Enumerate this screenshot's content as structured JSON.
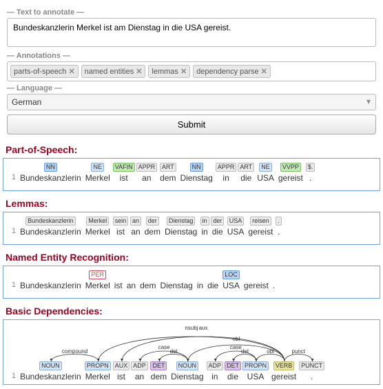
{
  "form": {
    "text_legend": "— Text to annotate —",
    "text_value": "Bundeskanzlerin Merkel ist am Dienstag in die USA gereist.",
    "annotations_legend": "— Annotations —",
    "tags": [
      {
        "label": "parts-of-speech"
      },
      {
        "label": "named entities"
      },
      {
        "label": "lemmas"
      },
      {
        "label": "dependency parse"
      }
    ],
    "tag_close": "✕",
    "language_legend": "— Language —",
    "language_value": "German",
    "submit_label": "Submit"
  },
  "sections": {
    "pos_title": "Part-of-Speech:",
    "lemma_title": "Lemmas:",
    "ner_title": "Named Entity Recognition:",
    "dep_title": "Basic Dependencies:",
    "line_num": "1"
  },
  "sentence_tokens": [
    "Bundeskanzlerin",
    "Merkel",
    "ist",
    "an",
    "dem",
    "Dienstag",
    "in",
    "die",
    "USA",
    "gereist",
    "."
  ],
  "pos_tags": [
    {
      "tag": "NN",
      "cls": "c-blue"
    },
    {
      "tag": "NE",
      "cls": "c-lblue"
    },
    {
      "tag": "VAFIN",
      "cls": "c-green"
    },
    {
      "tag": "APPR",
      "cls": "c-gray"
    },
    {
      "tag": "ART",
      "cls": "c-gray"
    },
    {
      "tag": "NN",
      "cls": "c-blue"
    },
    {
      "tag": "APPR",
      "cls": "c-gray"
    },
    {
      "tag": "ART",
      "cls": "c-gray"
    },
    {
      "tag": "NE",
      "cls": "c-lblue"
    },
    {
      "tag": "VVPP",
      "cls": "c-green"
    },
    {
      "tag": "$.",
      "cls": "c-gray"
    }
  ],
  "lemmas": [
    "Bundeskanzlerin",
    "Merkel",
    "sein",
    "an",
    "der",
    "Dienstag",
    "in",
    "der",
    "USA",
    "reisen",
    "."
  ],
  "ner": [
    {
      "word": "Bundeskanzlerin"
    },
    {
      "word": "Merkel",
      "tag": "PER",
      "cls": "c-red"
    },
    {
      "word": "ist"
    },
    {
      "word": "an"
    },
    {
      "word": "dem"
    },
    {
      "word": "Dienstag"
    },
    {
      "word": "in"
    },
    {
      "word": "die"
    },
    {
      "word": "USA",
      "tag": "LOC",
      "cls": "c-blue"
    },
    {
      "word": "gereist"
    },
    {
      "word": "."
    }
  ],
  "dep_tokens": [
    {
      "word": "Bundeskanzlerin",
      "tag": "NOUN",
      "cls": "c-lblue"
    },
    {
      "word": "Merkel",
      "tag": "PROPN",
      "cls": "c-lblue"
    },
    {
      "word": "ist",
      "tag": "AUX",
      "cls": "c-gray"
    },
    {
      "word": "an",
      "tag": "ADP",
      "cls": "c-gray"
    },
    {
      "word": "dem",
      "tag": "DET",
      "cls": "c-purple"
    },
    {
      "word": "Dienstag",
      "tag": "NOUN",
      "cls": "c-lblue"
    },
    {
      "word": "in",
      "tag": "ADP",
      "cls": "c-gray"
    },
    {
      "word": "die",
      "tag": "DET",
      "cls": "c-purple"
    },
    {
      "word": "USA",
      "tag": "PROPN",
      "cls": "c-lblue"
    },
    {
      "word": "gereist",
      "tag": "VERB",
      "cls": "c-yellow"
    },
    {
      "word": ".",
      "tag": "PUNCT",
      "cls": "c-gray"
    }
  ],
  "deps": [
    {
      "from": 1,
      "to": 0,
      "label": "compound"
    },
    {
      "from": 9,
      "to": 1,
      "label": "nsubj"
    },
    {
      "from": 9,
      "to": 2,
      "label": "aux"
    },
    {
      "from": 5,
      "to": 3,
      "label": "case"
    },
    {
      "from": 5,
      "to": 4,
      "label": "det"
    },
    {
      "from": 9,
      "to": 5,
      "label": "obl"
    },
    {
      "from": 8,
      "to": 6,
      "label": "case"
    },
    {
      "from": 8,
      "to": 7,
      "label": "det"
    },
    {
      "from": 9,
      "to": 8,
      "label": "obl"
    },
    {
      "from": 9,
      "to": 10,
      "label": "punct"
    }
  ]
}
